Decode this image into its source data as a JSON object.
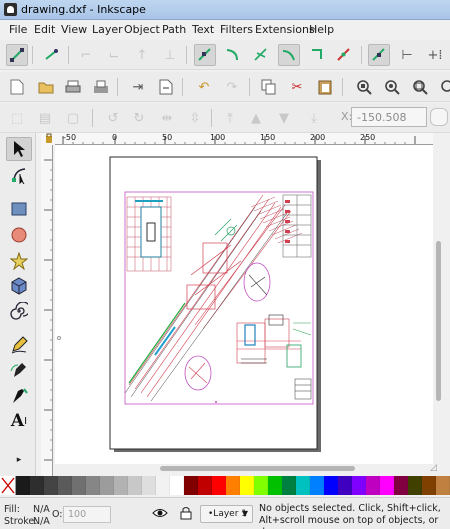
{
  "window": {
    "title": "drawing.dxf - Inkscape"
  },
  "menu": [
    "File",
    "Edit",
    "View",
    "Layer",
    "Object",
    "Path",
    "Text",
    "Filters",
    "Extensions",
    "Help"
  ],
  "toolbar": {
    "x_label": "X:",
    "x_value": "-150.508"
  },
  "ruler": {
    "top_ticks": [
      "-50",
      "0",
      "50",
      "100",
      "150",
      "200",
      "250"
    ]
  },
  "palette": [
    "#1a1a1a",
    "#2e2e2e",
    "#444444",
    "#5a5a5a",
    "#707070",
    "#868686",
    "#9c9c9c",
    "#b2b2b2",
    "#c8c8c8",
    "#dedede",
    "#f2f2f2",
    "#ffffff",
    "#800000",
    "#c00000",
    "#ff0000",
    "#ff8000",
    "#ffff00",
    "#80ff00",
    "#00c000",
    "#008040",
    "#00c0c0",
    "#0080ff",
    "#0000ff",
    "#4000c0",
    "#8000ff",
    "#c000c0",
    "#ff00ff",
    "#800040",
    "#404000",
    "#804000",
    "#c08040"
  ],
  "status": {
    "fill_label": "Fill:",
    "fill_value": "N/A",
    "stroke_label": "Stroke:",
    "stroke_value": "N/A",
    "opacity_label": "O:",
    "opacity_value": "100",
    "layer": "•Layer 1",
    "message_line1": "No objects selected. Click, Shift+click,",
    "message_line2": "Alt+scroll mouse on top of objects, or drag ..."
  }
}
